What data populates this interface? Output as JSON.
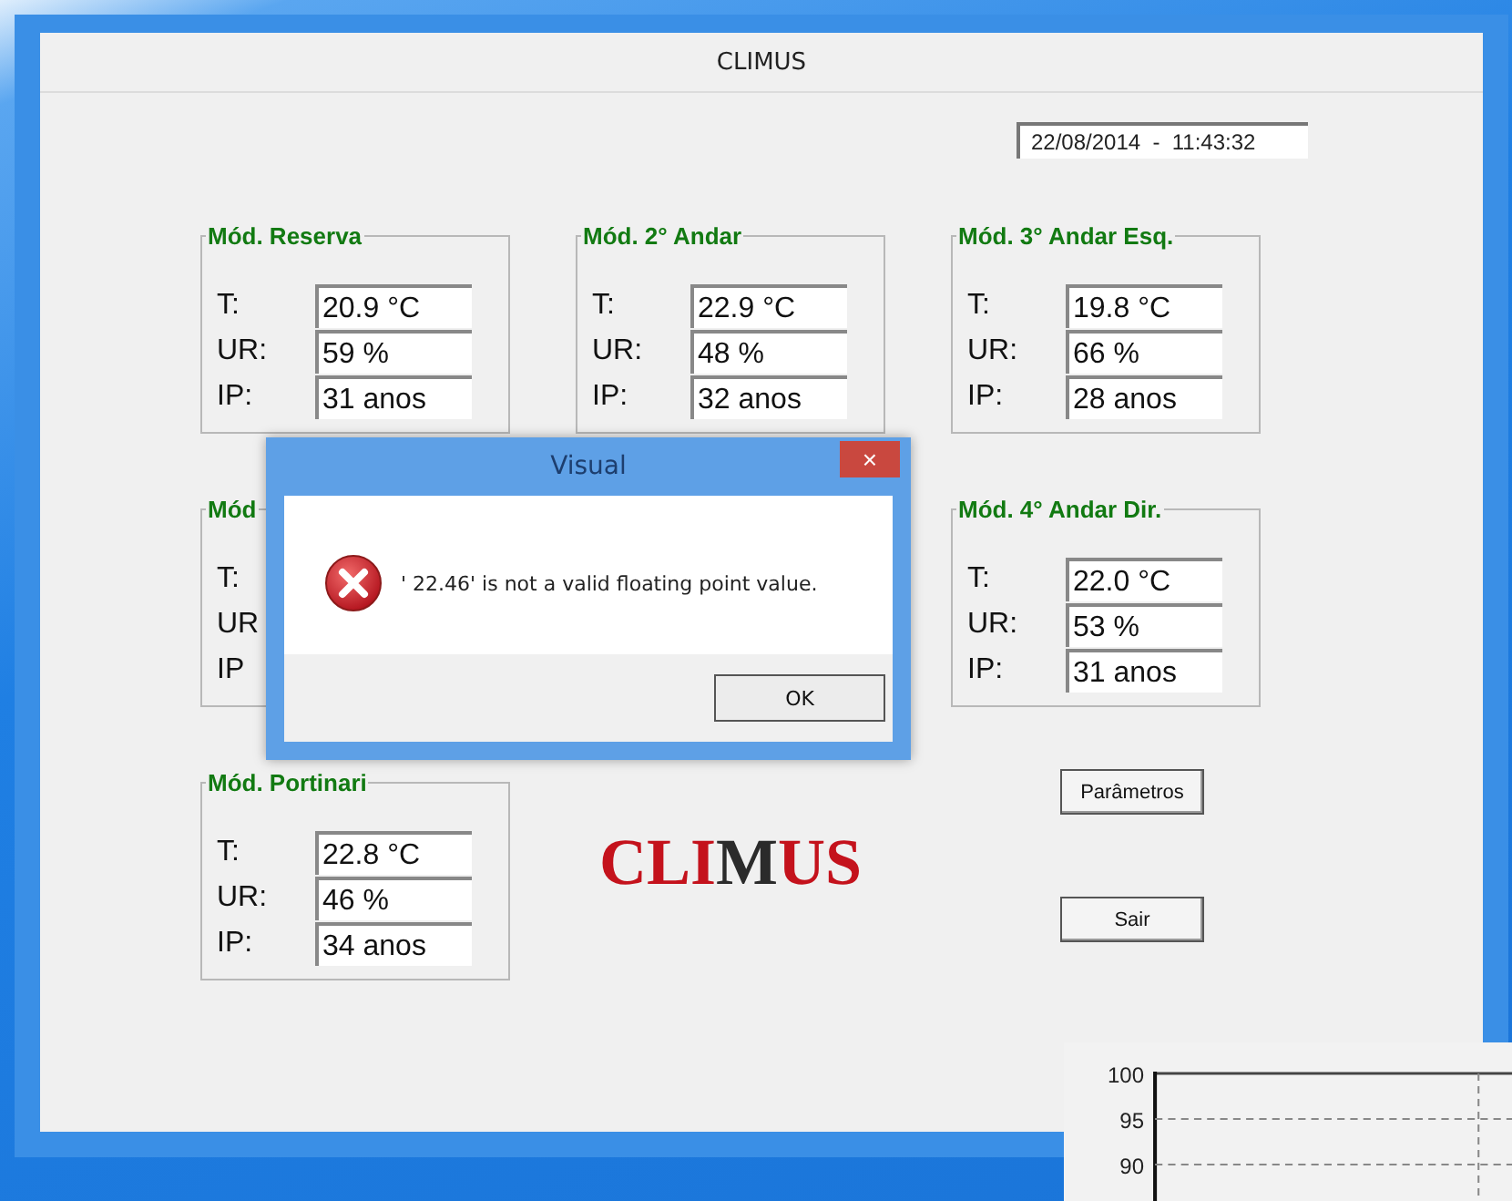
{
  "main_window": {
    "title": "CLIMUS",
    "datetime": "22/08/2014  -  11:43:32",
    "modules": [
      {
        "title": "Mód. Reserva",
        "readings": [
          {
            "label": "T:",
            "value": "20.9 °C"
          },
          {
            "label": "UR:",
            "value": "59 %"
          },
          {
            "label": "IP:",
            "value": "31 anos"
          }
        ]
      },
      {
        "title": "Mód. 2° Andar",
        "readings": [
          {
            "label": "T:",
            "value": "22.9 °C"
          },
          {
            "label": "UR:",
            "value": "48 %"
          },
          {
            "label": "IP:",
            "value": "32 anos"
          }
        ]
      },
      {
        "title": "Mód. 3° Andar Esq.",
        "readings": [
          {
            "label": "T:",
            "value": "19.8 °C"
          },
          {
            "label": "UR:",
            "value": "66 %"
          },
          {
            "label": "IP:",
            "value": "28 anos"
          }
        ]
      },
      {
        "title": "Mód",
        "readings": [
          {
            "label": "T:"
          },
          {
            "label": "UR"
          },
          {
            "label": "IP"
          }
        ]
      },
      {
        "title": "Mód. 4° Andar Dir.",
        "readings": [
          {
            "label": "T:",
            "value": "22.0 °C"
          },
          {
            "label": "UR:",
            "value": "53 %"
          },
          {
            "label": "IP:",
            "value": "31 anos"
          }
        ]
      },
      {
        "title": "Mód. Portinari",
        "readings": [
          {
            "label": "T:",
            "value": "22.8 °C"
          },
          {
            "label": "UR:",
            "value": "46 %"
          },
          {
            "label": "IP:",
            "value": "34 anos"
          }
        ]
      }
    ],
    "logo": [
      {
        "text": "CLI",
        "color": "#c4121c"
      },
      {
        "text": "M",
        "color": "#2b2b2b"
      },
      {
        "text": "US",
        "color": "#c4121c"
      }
    ],
    "buttons": [
      "Parâmetros",
      "Sair"
    ]
  },
  "dialog": {
    "title": "Visual",
    "close": "×",
    "message": "' 22.46' is not a valid floating point value.",
    "button": "OK"
  },
  "chart_window": {
    "y_axis_labels": [
      "100",
      "95",
      "90"
    ]
  }
}
